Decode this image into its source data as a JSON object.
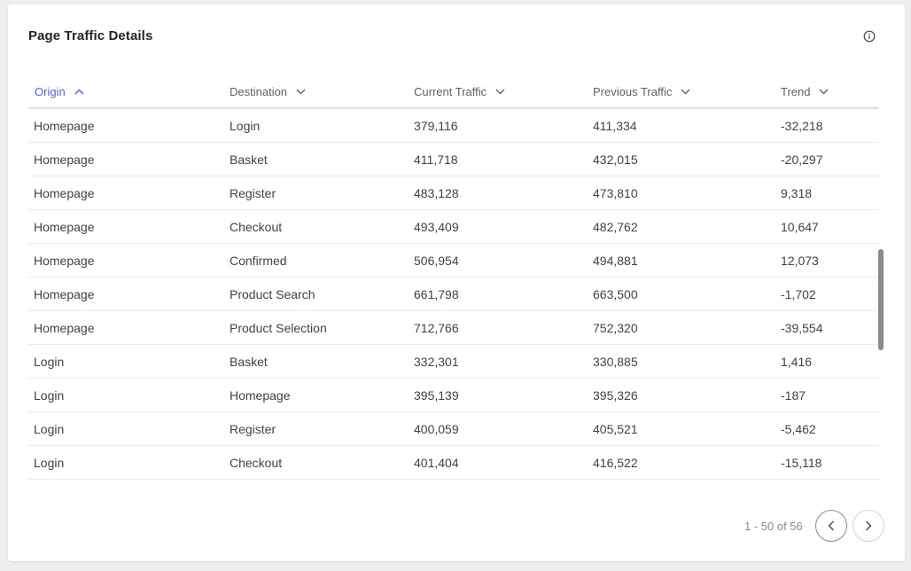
{
  "card": {
    "title": "Page Traffic Details",
    "info_icon": "info-circle-icon"
  },
  "table": {
    "columns": [
      {
        "label": "Origin",
        "sort": "ascending",
        "icon": "chevron-up-icon"
      },
      {
        "label": "Destination",
        "sort": "none",
        "icon": "chevron-down-icon"
      },
      {
        "label": "Current Traffic",
        "sort": "none",
        "icon": "chevron-down-icon"
      },
      {
        "label": "Previous Traffic",
        "sort": "none",
        "icon": "chevron-down-icon"
      },
      {
        "label": "Trend",
        "sort": "none",
        "icon": "chevron-down-icon"
      }
    ],
    "rows": [
      [
        "Homepage",
        "Login",
        "379,116",
        "411,334",
        "-32,218"
      ],
      [
        "Homepage",
        "Basket",
        "411,718",
        "432,015",
        "-20,297"
      ],
      [
        "Homepage",
        "Register",
        "483,128",
        "473,810",
        "9,318"
      ],
      [
        "Homepage",
        "Checkout",
        "493,409",
        "482,762",
        "10,647"
      ],
      [
        "Homepage",
        "Confirmed",
        "506,954",
        "494,881",
        "12,073"
      ],
      [
        "Homepage",
        "Product Search",
        "661,798",
        "663,500",
        "-1,702"
      ],
      [
        "Homepage",
        "Product Selection",
        "712,766",
        "752,320",
        "-39,554"
      ],
      [
        "Login",
        "Basket",
        "332,301",
        "330,885",
        "1,416"
      ],
      [
        "Login",
        "Homepage",
        "395,139",
        "395,326",
        "-187"
      ],
      [
        "Login",
        "Register",
        "400,059",
        "405,521",
        "-5,462"
      ],
      [
        "Login",
        "Checkout",
        "401,404",
        "416,522",
        "-15,118"
      ]
    ]
  },
  "pagination": {
    "range_text": "1 - 50 of 56",
    "prev_icon": "chevron-left-icon",
    "next_icon": "chevron-right-icon"
  },
  "colors": {
    "accent": "#5b5fc7",
    "header_text": "#616161",
    "body_text": "#424242",
    "muted_text": "#8a8a8a"
  }
}
